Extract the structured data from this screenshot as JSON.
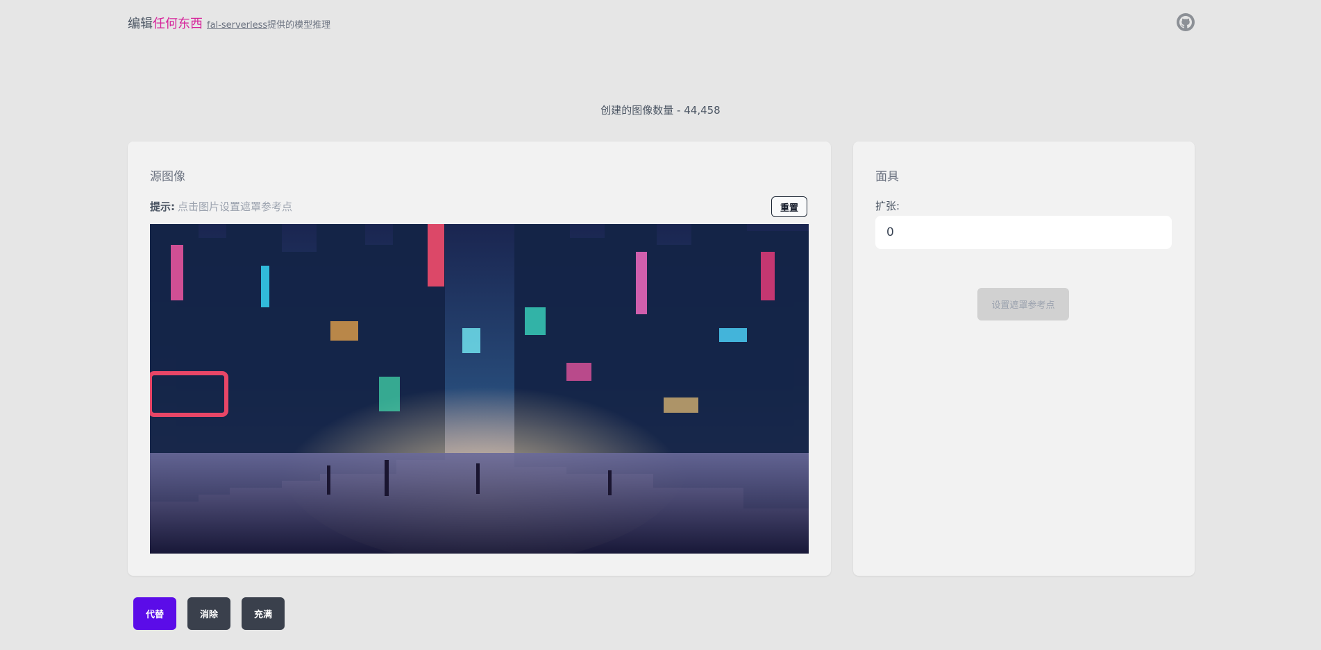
{
  "header": {
    "title_prefix": "编辑",
    "title_highlight": "任何东西",
    "link_text": "fal-serverless",
    "link_suffix": "提供的模型推理",
    "github_icon": "github-icon"
  },
  "stats": {
    "images_created": "创建的图像数量 - 44,458"
  },
  "source_panel": {
    "title": "源图像",
    "hint_label": "提示:",
    "hint_text": "点击图片设置遮罩参考点",
    "reset_label": "重置"
  },
  "mask_panel": {
    "title": "面具",
    "expand_label": "扩张:",
    "expand_value": "0",
    "set_points_label": "设置遮罩参考点"
  },
  "actions": {
    "replace_label": "代替",
    "remove_label": "消除",
    "fill_label": "充满"
  },
  "colors": {
    "accent": "#d6239a",
    "primary_button": "#5b0ce8",
    "dark_button": "#3a404c",
    "page_bg": "#e6e6e6",
    "card_bg": "#f2f2f2"
  }
}
